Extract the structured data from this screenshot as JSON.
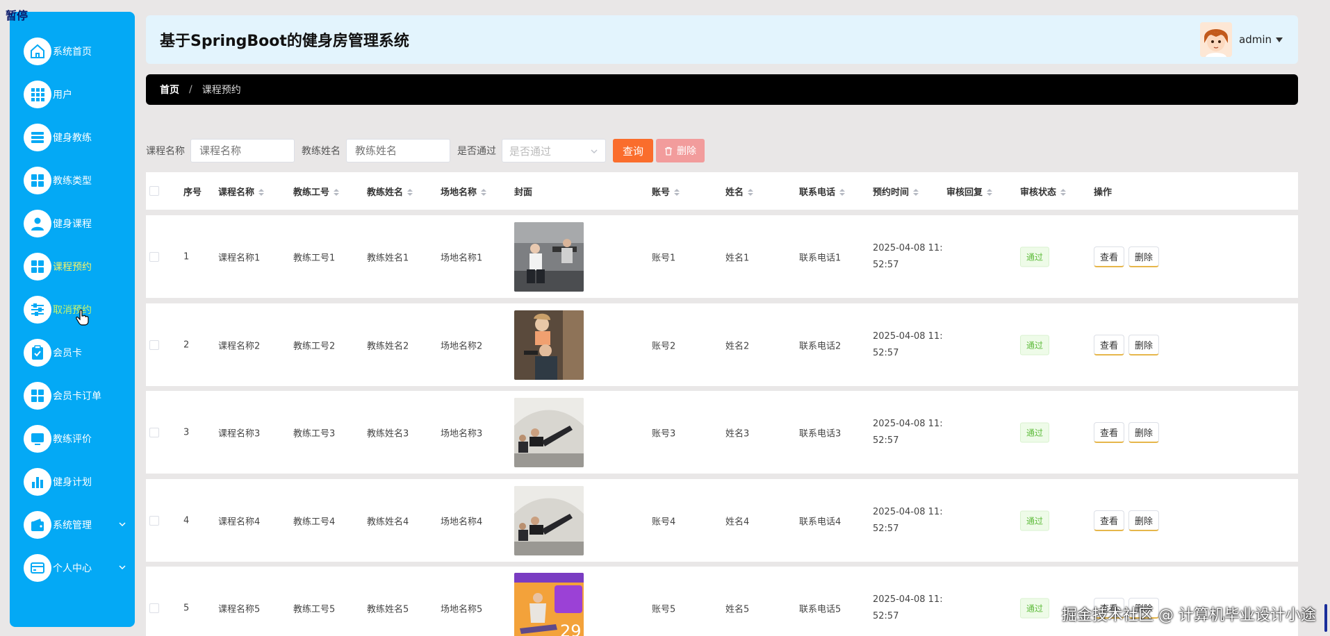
{
  "overlay": {
    "pause": "暂停"
  },
  "sidebar": {
    "items": [
      {
        "label": "系统首页",
        "icon": "home-icon"
      },
      {
        "label": "用户",
        "icon": "grid-icon"
      },
      {
        "label": "健身教练",
        "icon": "list-icon"
      },
      {
        "label": "教练类型",
        "icon": "apps-icon"
      },
      {
        "label": "健身课程",
        "icon": "person-icon"
      },
      {
        "label": "课程预约",
        "icon": "apps-icon"
      },
      {
        "label": "取消预约",
        "icon": "sliders-icon"
      },
      {
        "label": "会员卡",
        "icon": "clipboard-icon"
      },
      {
        "label": "会员卡订单",
        "icon": "apps-icon"
      },
      {
        "label": "教练评价",
        "icon": "monitor-icon"
      },
      {
        "label": "健身计划",
        "icon": "bar-chart-icon"
      },
      {
        "label": "系统管理",
        "icon": "wallet-icon"
      },
      {
        "label": "个人中心",
        "icon": "card-icon"
      }
    ],
    "active_color": "#f5f26a",
    "bg_color": "#04a9f5"
  },
  "header": {
    "title": "基于SpringBoot的健身房管理系统",
    "user": "admin"
  },
  "breadcrumb": {
    "home": "首页",
    "separator": "/",
    "current": "课程预约"
  },
  "search": {
    "course_label": "课程名称",
    "course_placeholder": "课程名称",
    "coach_label": "教练姓名",
    "coach_placeholder": "教练姓名",
    "pass_label": "是否通过",
    "pass_placeholder": "是否通过",
    "query_label": "查询",
    "delete_label": "删除"
  },
  "table": {
    "headers": {
      "index": "序号",
      "course": "课程名称",
      "coach_no": "教练工号",
      "coach_name": "教练姓名",
      "venue": "场地名称",
      "cover": "封面",
      "account": "账号",
      "name": "姓名",
      "phone": "联系电话",
      "time": "预约时间",
      "reply": "审核回复",
      "status": "审核状态",
      "ops": "操作"
    },
    "rows": [
      {
        "index": "1",
        "course": "课程名称1",
        "coach_no": "教练工号1",
        "coach_name": "教练姓名1",
        "venue": "场地名称1",
        "account": "账号1",
        "name": "姓名1",
        "phone": "联系电话1",
        "time_date": "2025-04-08 11:",
        "time_rest": "52:57",
        "status": "通过"
      },
      {
        "index": "2",
        "course": "课程名称2",
        "coach_no": "教练工号2",
        "coach_name": "教练姓名2",
        "venue": "场地名称2",
        "account": "账号2",
        "name": "姓名2",
        "phone": "联系电话2",
        "time_date": "2025-04-08 11:",
        "time_rest": "52:57",
        "status": "通过"
      },
      {
        "index": "3",
        "course": "课程名称3",
        "coach_no": "教练工号3",
        "coach_name": "教练姓名3",
        "venue": "场地名称3",
        "account": "账号3",
        "name": "姓名3",
        "phone": "联系电话3",
        "time_date": "2025-04-08 11:",
        "time_rest": "52:57",
        "status": "通过"
      },
      {
        "index": "4",
        "course": "课程名称4",
        "coach_no": "教练工号4",
        "coach_name": "教练姓名4",
        "venue": "场地名称4",
        "account": "账号4",
        "name": "姓名4",
        "phone": "联系电话4",
        "time_date": "2025-04-08 11:",
        "time_rest": "52:57",
        "status": "通过"
      },
      {
        "index": "5",
        "course": "课程名称5",
        "coach_no": "教练工号5",
        "coach_name": "教练姓名5",
        "venue": "场地名称5",
        "account": "账号5",
        "name": "姓名5",
        "phone": "联系电话5",
        "time_date": "2025-04-08 11:",
        "time_rest": "52:57",
        "status": "通过"
      }
    ],
    "view_label": "查看",
    "delete_label": "删除"
  },
  "watermark": "掘金技术社区 @ 计算机毕业设计小途"
}
